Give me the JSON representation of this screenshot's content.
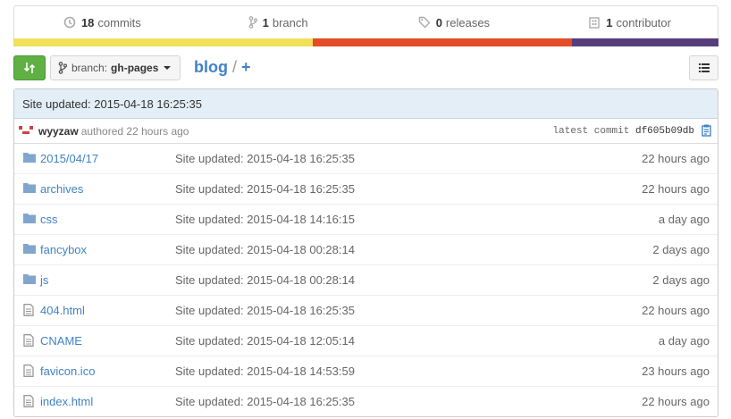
{
  "summary": {
    "commits": {
      "count": "18",
      "label": "commits",
      "icon": "history-icon"
    },
    "branches": {
      "count": "1",
      "label": "branch",
      "icon": "branch-icon"
    },
    "releases": {
      "count": "0",
      "label": "releases",
      "icon": "tag-icon"
    },
    "contributors": {
      "count": "1",
      "label": "contributor",
      "icon": "organization-icon"
    },
    "language_colors": [
      "#f1e05a",
      "#e34c26",
      "#563d7c"
    ]
  },
  "toolbar": {
    "branch_prefix": "branch:",
    "branch_name": "gh-pages",
    "repo": "blog",
    "separator": "/",
    "plus": "+"
  },
  "commit": {
    "message": "Site updated: 2015-04-18 16:25:35",
    "author": "wyyzaw",
    "authored": "authored 22 hours ago",
    "latest_label": "latest commit",
    "sha": "df605b09db"
  },
  "files": [
    {
      "type": "dir",
      "name": "2015/04/17",
      "message": "Site updated: 2015-04-18 16:25:35",
      "age": "22 hours ago"
    },
    {
      "type": "dir",
      "name": "archives",
      "message": "Site updated: 2015-04-18 16:25:35",
      "age": "22 hours ago"
    },
    {
      "type": "dir",
      "name": "css",
      "message": "Site updated: 2015-04-18 14:16:15",
      "age": "a day ago"
    },
    {
      "type": "dir",
      "name": "fancybox",
      "message": "Site updated: 2015-04-18 00:28:14",
      "age": "2 days ago"
    },
    {
      "type": "dir",
      "name": "js",
      "message": "Site updated: 2015-04-18 00:28:14",
      "age": "2 days ago"
    },
    {
      "type": "file",
      "name": "404.html",
      "message": "Site updated: 2015-04-18 16:25:35",
      "age": "22 hours ago"
    },
    {
      "type": "file",
      "name": "CNAME",
      "message": "Site updated: 2015-04-18 12:05:14",
      "age": "a day ago"
    },
    {
      "type": "file",
      "name": "favicon.ico",
      "message": "Site updated: 2015-04-18 14:53:59",
      "age": "23 hours ago"
    },
    {
      "type": "file",
      "name": "index.html",
      "message": "Site updated: 2015-04-18 16:25:35",
      "age": "22 hours ago"
    }
  ]
}
